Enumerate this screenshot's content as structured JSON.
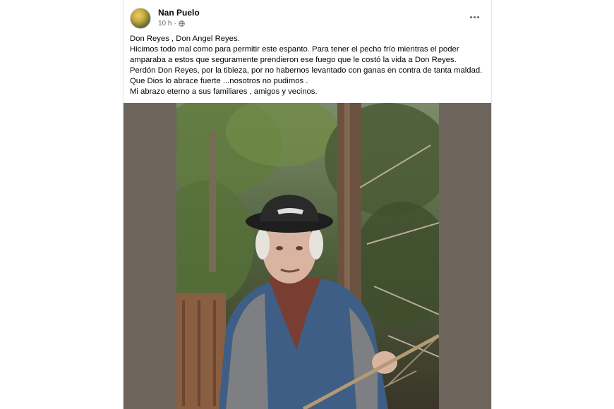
{
  "post": {
    "author": "Nan Puelo",
    "time": "10 h",
    "separator": "·",
    "icons": {
      "privacy": "globe-icon",
      "more": "more-options-icon"
    },
    "text_lines": [
      "Don Reyes , Don Angel Reyes.",
      "Hicimos todo mal como para permitir este espanto. Para tener el pecho frío mientras el poder",
      "amparaba a estos que seguramente prendieron ese fuego que le costó la vida a Don Reyes.",
      "Perdón Don Reyes, por la tibieza, por no habernos levantado con ganas en contra de tanta maldad.",
      "Que Dios lo abrace fuerte ...nosotros no pudimos .",
      "Mi abrazo eterno a sus familiares , amigos y vecinos."
    ]
  },
  "colors": {
    "author_text": "#050505",
    "meta_text": "#65676b",
    "media_background": "#6e655d"
  }
}
